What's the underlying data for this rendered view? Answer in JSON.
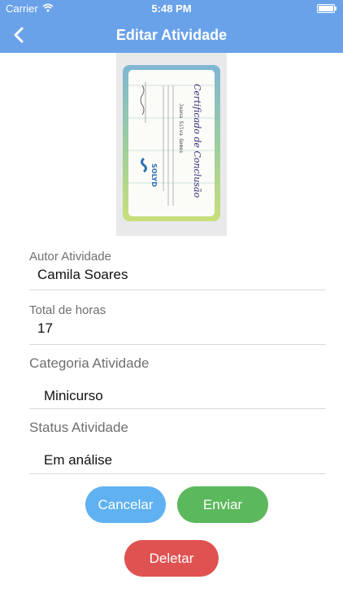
{
  "status_bar": {
    "carrier": "Carrier",
    "time": "5:48 PM"
  },
  "nav": {
    "title": "Editar Atividade"
  },
  "certificate": {
    "heading": "Certificado de Conclusão",
    "recipient": "Joana Silva Gomes",
    "logo_text": "SOLYD",
    "body_text": "Concluiu o curso livre de Introdução ao Hacking Ético, com carga horária de 17 horas"
  },
  "form": {
    "author": {
      "label": "Autor Atividade",
      "value": "Camila Soares"
    },
    "hours": {
      "label": "Total de horas",
      "value": "17"
    },
    "category": {
      "label": "Categoria Atividade",
      "value": "Minicurso"
    },
    "status": {
      "label": "Status Atividade",
      "value": "Em análise"
    }
  },
  "buttons": {
    "cancel": "Cancelar",
    "send": "Enviar",
    "delete": "Deletar"
  },
  "colors": {
    "nav": "#6aa2ea",
    "cancel": "#5fb1f1",
    "send": "#5cb85c",
    "delete": "#e05251"
  }
}
